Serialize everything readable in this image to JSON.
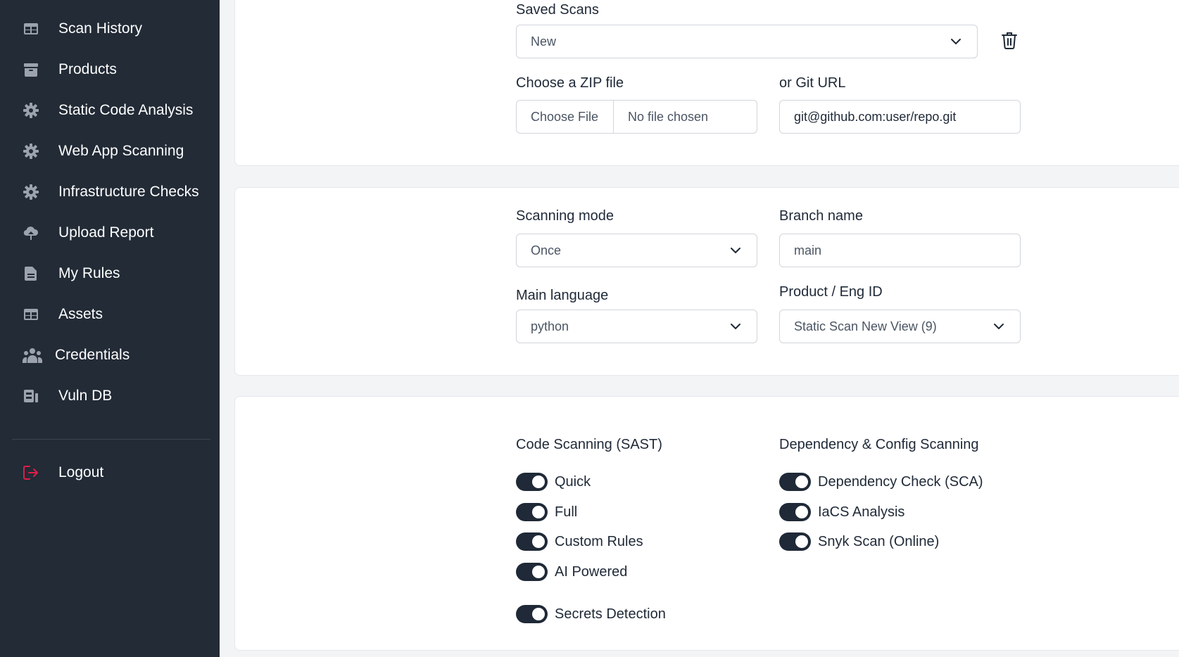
{
  "sidebar": {
    "items": [
      {
        "label": "Scan History",
        "icon": "table-icon"
      },
      {
        "label": "Products",
        "icon": "archive-icon"
      },
      {
        "label": "Static Code Analysis",
        "icon": "gear-icon"
      },
      {
        "label": "Web App Scanning",
        "icon": "gear-icon"
      },
      {
        "label": "Infrastructure Checks",
        "icon": "gear-icon"
      },
      {
        "label": "Upload Report",
        "icon": "cloud-upload-icon"
      },
      {
        "label": "My Rules",
        "icon": "file-icon"
      },
      {
        "label": "Assets",
        "icon": "table-icon"
      },
      {
        "label": "Credentials",
        "icon": "users-icon"
      },
      {
        "label": "Vuln DB",
        "icon": "database-icon"
      }
    ],
    "logout_label": "Logout",
    "logout_icon": "logout-icon",
    "accent_color": "#e11d48"
  },
  "source": {
    "saved_scans_label": "Saved Scans",
    "saved_scans_value": "New",
    "zip_label": "Choose a ZIP file",
    "file_button": "Choose File",
    "file_name": "No file chosen",
    "git_label": "or Git URL",
    "git_value": "git@github.com:user/repo.git"
  },
  "settings": {
    "mode_label": "Scanning mode",
    "mode_value": "Once",
    "branch_label": "Branch name",
    "branch_value": "main",
    "language_label": "Main language",
    "language_value": "python",
    "product_label": "Product / Eng ID",
    "product_value": "Static Scan New View (9)"
  },
  "options": {
    "sast_title": "Code Scanning (SAST)",
    "sast": [
      {
        "label": "Quick",
        "on": true
      },
      {
        "label": "Full",
        "on": true
      },
      {
        "label": "Custom Rules",
        "on": true
      },
      {
        "label": "AI Powered",
        "on": true
      },
      {
        "label": "Secrets Detection",
        "on": true
      }
    ],
    "dep_title": "Dependency & Config Scanning",
    "dep": [
      {
        "label": "Dependency Check (SCA)",
        "on": true
      },
      {
        "label": "IaCS Analysis",
        "on": true
      },
      {
        "label": "Snyk Scan (Online)",
        "on": true
      }
    ]
  }
}
